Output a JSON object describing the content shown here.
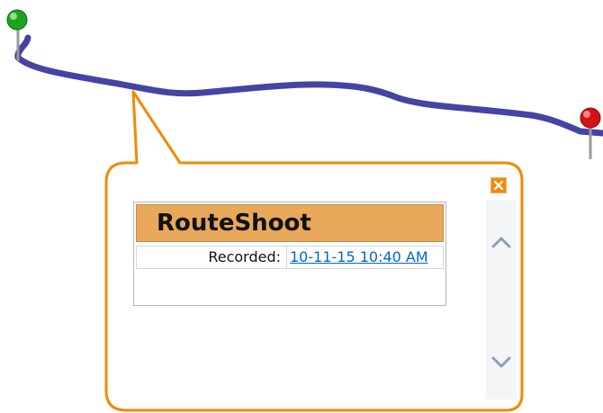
{
  "map": {
    "route_color": "#4444a4",
    "start_marker": {
      "icon": "green-pin-icon",
      "color": "#1fa31f"
    },
    "end_marker": {
      "icon": "red-pin-icon",
      "color": "#d41414"
    }
  },
  "popup": {
    "border_color": "#f28a00",
    "title": "RouteShoot",
    "title_bg": "#e8a85c",
    "recorded_label": "Recorded:",
    "recorded_value": "10-11-15 10:40 AM",
    "close_icon": "close-icon",
    "scroll_up_icon": "chevron-up-icon",
    "scroll_down_icon": "chevron-down-icon"
  }
}
